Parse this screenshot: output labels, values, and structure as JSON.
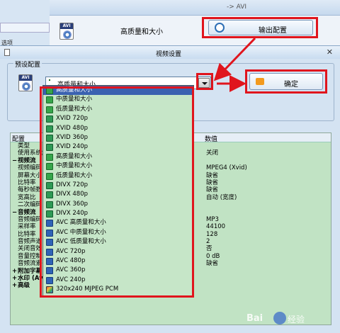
{
  "background_window": {
    "title": "-> AVI",
    "left_tab_label": "选项",
    "preset_text": "高质量和大小",
    "output_config_button": "输出配置"
  },
  "dialog": {
    "title": "视频设置",
    "close_glyph": "✕",
    "preset_group_label": "预设配置",
    "combo_value": "高质量和大小",
    "ok_button": "确定"
  },
  "property_grid": {
    "col_config": "配置",
    "col_value": "数值",
    "rows": [
      {
        "name": "类型",
        "value": "",
        "bold": false,
        "expander": ""
      },
      {
        "name": "使用系统解",
        "value": "关闭",
        "bold": false,
        "expander": ""
      },
      {
        "name": "视频流",
        "value": "",
        "bold": true,
        "expander": "−"
      },
      {
        "name": "视频编码",
        "value": "MPEG4 (Xvid)",
        "bold": false,
        "expander": ""
      },
      {
        "name": "屏幕大小",
        "value": "缺省",
        "bold": false,
        "expander": ""
      },
      {
        "name": "比特率",
        "value": "缺省",
        "bold": false,
        "expander": ""
      },
      {
        "name": "每秒帧数",
        "value": "缺省",
        "bold": false,
        "expander": ""
      },
      {
        "name": "宽高比",
        "value": "自动 (宽度)",
        "bold": false,
        "expander": ""
      },
      {
        "name": "二次编码",
        "value": "",
        "bold": false,
        "expander": ""
      },
      {
        "name": "音频流",
        "value": "",
        "bold": true,
        "expander": "−"
      },
      {
        "name": "音频编码",
        "value": "MP3",
        "bold": false,
        "expander": ""
      },
      {
        "name": "采样率",
        "value": "44100",
        "bold": false,
        "expander": ""
      },
      {
        "name": "比特率",
        "value": "128",
        "bold": false,
        "expander": ""
      },
      {
        "name": "音频声道",
        "value": "2",
        "bold": false,
        "expander": ""
      },
      {
        "name": "关闭音效",
        "value": "否",
        "bold": false,
        "expander": ""
      },
      {
        "name": "音量控制",
        "value": "0 dB",
        "bold": false,
        "expander": ""
      },
      {
        "name": "音频流索引",
        "value": "缺省",
        "bold": false,
        "expander": ""
      },
      {
        "name": "附加字幕",
        "value": "",
        "bold": true,
        "expander": "+"
      },
      {
        "name": "水印 (AviSynth)",
        "value": "",
        "bold": true,
        "expander": "+"
      },
      {
        "name": "高级",
        "value": "",
        "bold": true,
        "expander": "+"
      }
    ]
  },
  "dropdown": {
    "items": [
      {
        "label": "高质量和大小",
        "icon": "green-media-icon",
        "selected": true
      },
      {
        "label": "中质量和大小",
        "icon": "green-media-icon",
        "selected": false
      },
      {
        "label": "低质量和大小",
        "icon": "green-media-icon",
        "selected": false
      },
      {
        "label": "XVID 720p",
        "icon": "film-icon",
        "selected": false
      },
      {
        "label": "XVID 480p",
        "icon": "film-icon",
        "selected": false
      },
      {
        "label": "XVID 360p",
        "icon": "film-icon",
        "selected": false
      },
      {
        "label": "XVID 240p",
        "icon": "film-icon",
        "selected": false
      },
      {
        "label": "高质量和大小",
        "icon": "green-media-icon",
        "selected": false
      },
      {
        "label": "中质量和大小",
        "icon": "green-media-icon",
        "selected": false
      },
      {
        "label": "低质量和大小",
        "icon": "green-media-icon",
        "selected": false
      },
      {
        "label": "DIVX 720p",
        "icon": "film-icon",
        "selected": false
      },
      {
        "label": "DIVX 480p",
        "icon": "film-icon",
        "selected": false
      },
      {
        "label": "DIVX 360p",
        "icon": "film-icon",
        "selected": false
      },
      {
        "label": "DIVX 240p",
        "icon": "film-icon",
        "selected": false
      },
      {
        "label": "AVC 高质量和大小",
        "icon": "blue-media-icon",
        "selected": false
      },
      {
        "label": "AVC 中质量和大小",
        "icon": "blue-media-icon",
        "selected": false
      },
      {
        "label": "AVC 低质量和大小",
        "icon": "blue-media-icon",
        "selected": false
      },
      {
        "label": "AVC 720p",
        "icon": "blue-media-icon",
        "selected": false
      },
      {
        "label": "AVC 480p",
        "icon": "blue-media-icon",
        "selected": false
      },
      {
        "label": "AVC 360p",
        "icon": "blue-media-icon",
        "selected": false
      },
      {
        "label": "AVC 240p",
        "icon": "blue-media-icon",
        "selected": false
      },
      {
        "label": "320x240 MJPEG PCM",
        "icon": "multicolor-media-icon",
        "selected": false
      }
    ]
  },
  "watermark": {
    "brand": "Bai",
    "suffix": "经验"
  },
  "colors": {
    "highlight_red": "#e0151d",
    "list_bg": "#c6e6c8",
    "selection_blue": "#3b62b0"
  }
}
